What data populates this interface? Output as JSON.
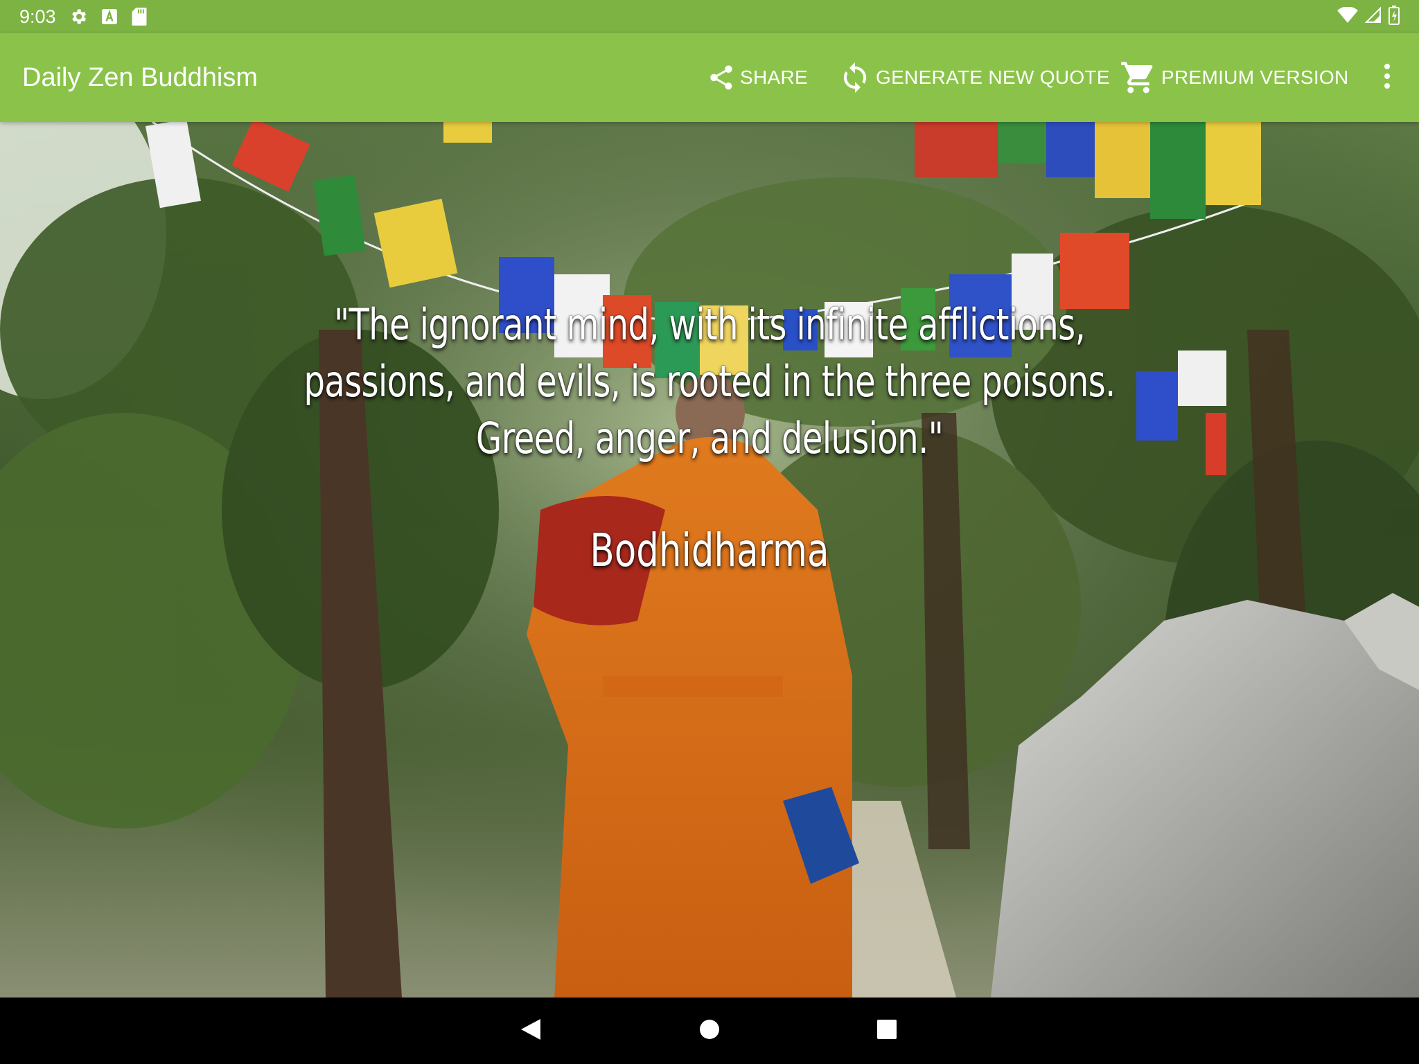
{
  "status_bar": {
    "time": "9:03",
    "icons_left": [
      "gear-icon",
      "font-a-icon",
      "sd-card-icon"
    ],
    "icons_right": [
      "wifi-icon",
      "signal-icon",
      "battery-icon"
    ]
  },
  "app_bar": {
    "title": "Daily Zen Buddhism",
    "actions": [
      {
        "label": "SHARE",
        "icon": "share-icon"
      },
      {
        "label": "GENERATE NEW QUOTE",
        "icon": "refresh-icon"
      },
      {
        "label": "PREMIUM VERSION",
        "icon": "cart-icon"
      }
    ],
    "overflow_icon": "more-vert-icon"
  },
  "quote": {
    "text": "\"The ignorant mind, with its infinite afflictions,\npassions, and evils, is rooted in the three poisons.\nGreed, anger, and delusion.\"",
    "author": "Bodhidharma"
  },
  "nav_bar": {
    "buttons": [
      "back-icon",
      "home-icon",
      "recents-icon"
    ]
  },
  "colors": {
    "status_bar": "#7cb342",
    "app_bar": "#8bc34a",
    "text": "#ffffff"
  }
}
